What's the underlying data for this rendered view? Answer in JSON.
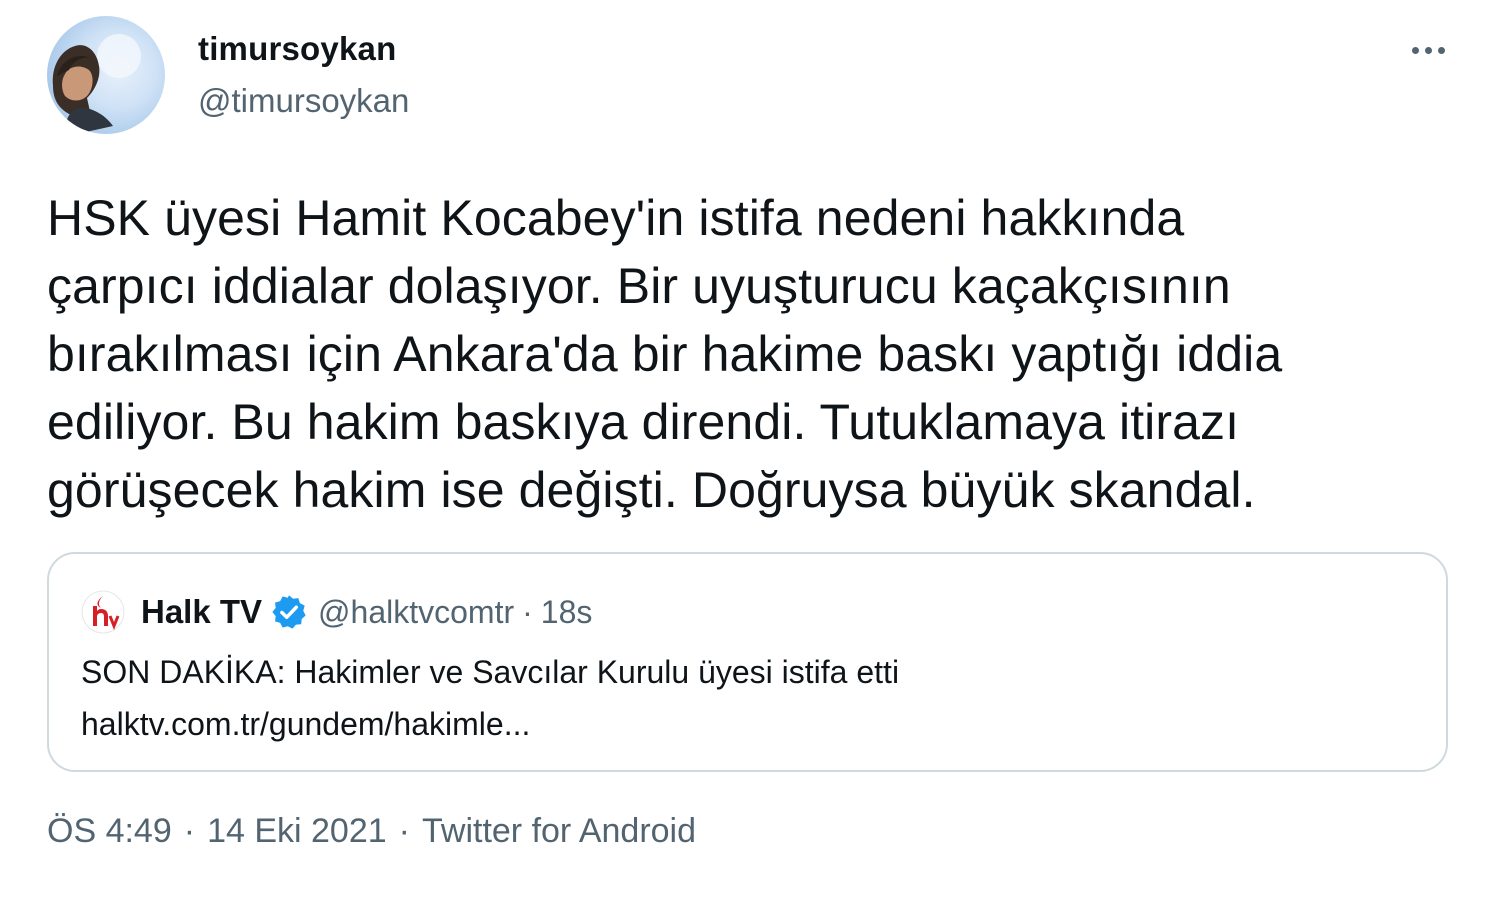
{
  "author": {
    "name": "timursoykan",
    "handle": "@timursoykan",
    "avatar": "profile-photo"
  },
  "menu": {
    "icon": "more-horizontal-icon"
  },
  "tweet": {
    "text": "HSK üyesi Hamit Kocabey'in istifa nedeni hakkında\nçarpıcı iddialar dolaşıyor. Bir uyuşturucu kaçakçısının\nbırakılması için Ankara'da bir hakime baskı yaptığı iddia\nediliyor. Bu hakim baskıya direndi. Tutuklamaya itirazı\ngörüşecek hakim ise değişti. Doğruysa büyük skandal."
  },
  "quote": {
    "logo": "halk-tv-logo",
    "name": "Halk TV",
    "verified_icon": "verified-badge-icon",
    "handle": "@halktvcomtr",
    "separator": "·",
    "time": "18s",
    "text": "SON DAKİKA: Hakimler ve Savcılar Kurulu üyesi istifa etti",
    "link": "halktv.com.tr/gundem/hakimle..."
  },
  "footer": {
    "time": "ÖS 4:49",
    "separator": "·",
    "date": "14 Eki 2021",
    "source": "Twitter for Android"
  },
  "colors": {
    "text": "#0f1419",
    "secondary": "#536471",
    "border": "#cfd9de",
    "verified": "#1d9bf0",
    "halk_red": "#d62027"
  }
}
